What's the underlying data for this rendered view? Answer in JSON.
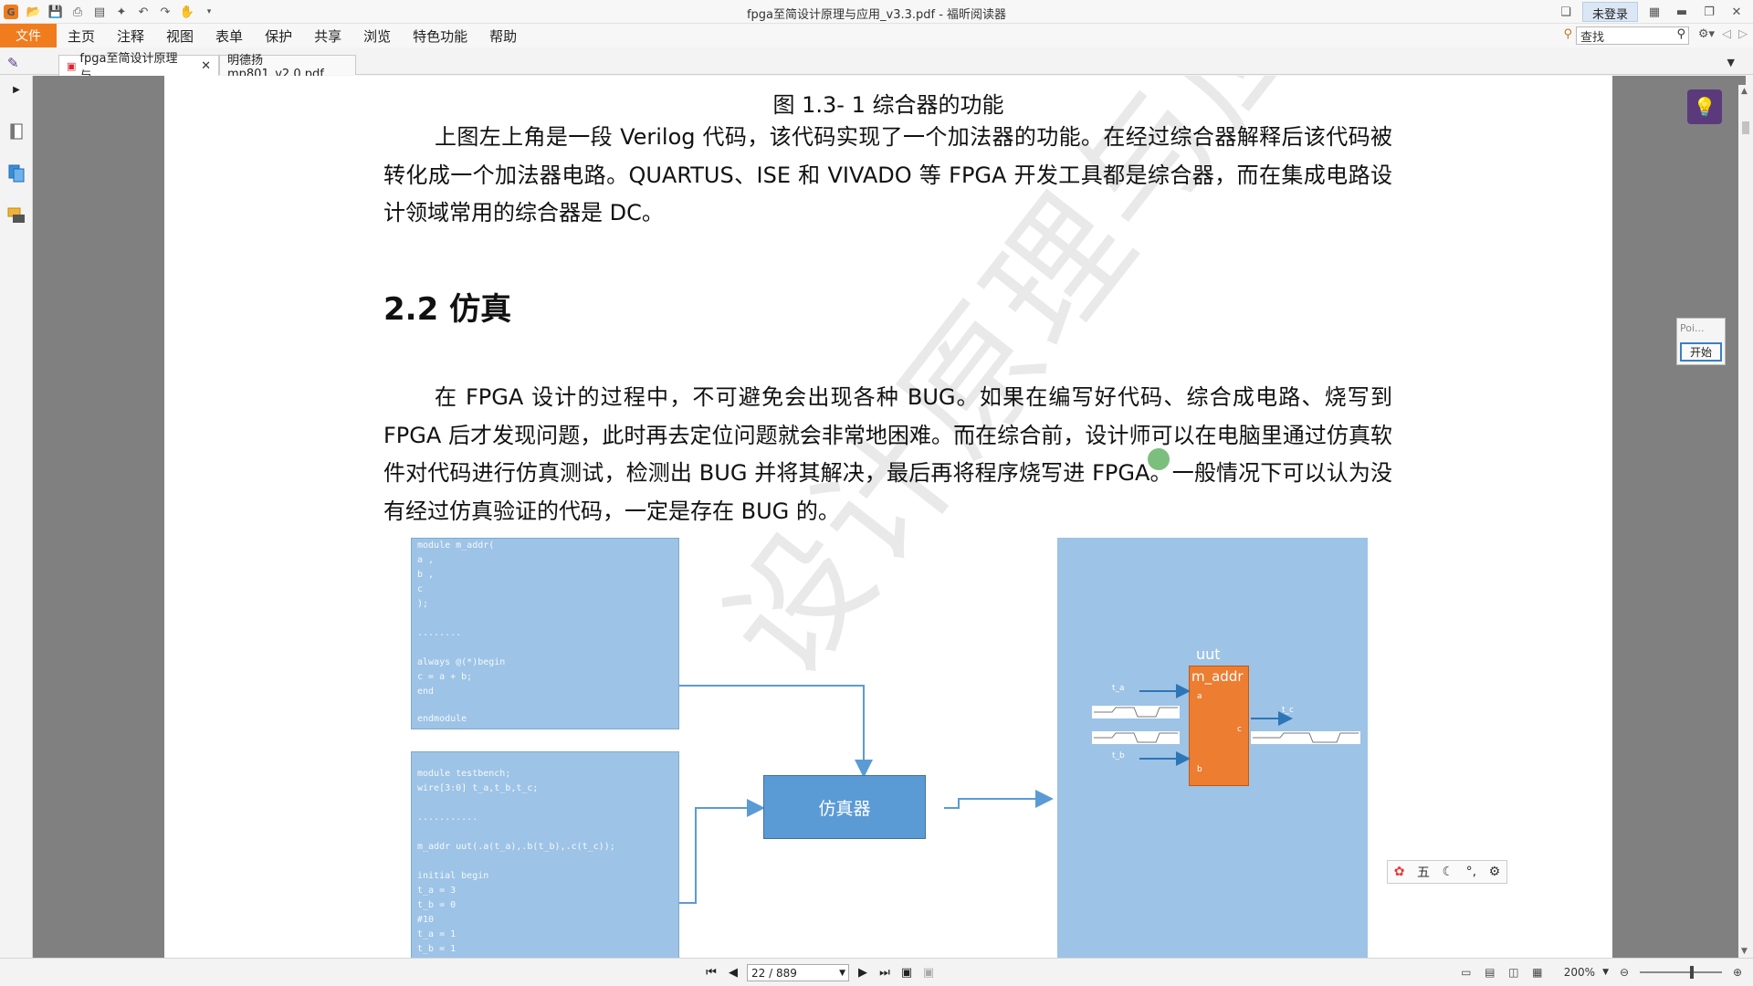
{
  "window": {
    "title": "fpga至简设计原理与应用_v3.3.pdf - 福昕阅读器",
    "login": "未登录"
  },
  "menu": {
    "file": "文件",
    "items": [
      "主页",
      "注释",
      "视图",
      "表单",
      "保护",
      "共享",
      "浏览",
      "特色功能",
      "帮助"
    ],
    "search_placeholder": "查找"
  },
  "tabs": [
    {
      "label": "fpga至简设计原理与...",
      "active": true
    },
    {
      "label": "明德扬mp801_v2.0.pdf",
      "active": false
    }
  ],
  "document": {
    "figure_caption": "图 1.3-  1 综合器的功能",
    "para1": "上图左上角是一段 Verilog 代码，该代码实现了一个加法器的功能。在经过综合器解释后该代码被转化成一个加法器电路。QUARTUS、ISE 和 VIVADO 等 FPGA 开发工具都是综合器，而在集成电路设计领域常用的综合器是 DC。",
    "section_title": "2.2  仿真",
    "para2": "在 FPGA 设计的过程中，不可避免会出现各种 BUG。如果在编写好代码、综合成电路、烧写到 FPGA 后才发现问题，此时再去定位问题就会非常地困难。而在综合前，设计师可以在电脑里通过仿真软件对代码进行仿真测试，检测出 BUG 并将其解决，最后再将程序烧写进 FPGA。一般情况下可以认为没有经过仿真验证的代码，一定是存在 BUG 的。",
    "watermark": "设计原理与应用",
    "diagram": {
      "code1_lines": [
        "module m_addr(",
        "  a ,",
        "  b ,",
        "  c",
        ");",
        "",
        "  ........",
        "",
        "  always @(*)begin",
        "    c = a + b;",
        "  end",
        "",
        "endmodule"
      ],
      "code2_lines": [
        "module testbench;",
        "  wire[3:0] t_a,t_b,t_c;",
        "",
        "  ...........",
        "",
        "  m_addr uut(.a(t_a),.b(t_b),.c(t_c));",
        "",
        "  initial begin",
        "    t_a = 3",
        "    t_b = 0",
        "    #10",
        "    t_a = 1",
        "    t_b = 1"
      ],
      "simulator_label": "仿真器",
      "uut_label": "uut",
      "module_label": "m_addr",
      "port_a": "a",
      "port_b": "b",
      "port_c": "c",
      "sig_a": "t_a",
      "sig_b": "t_b",
      "sig_c": "t_c"
    }
  },
  "poi": {
    "label": "Poi...",
    "start": "开始"
  },
  "ime": {
    "mode": "五"
  },
  "status": {
    "page": "22 / 889",
    "zoom": "200%"
  }
}
